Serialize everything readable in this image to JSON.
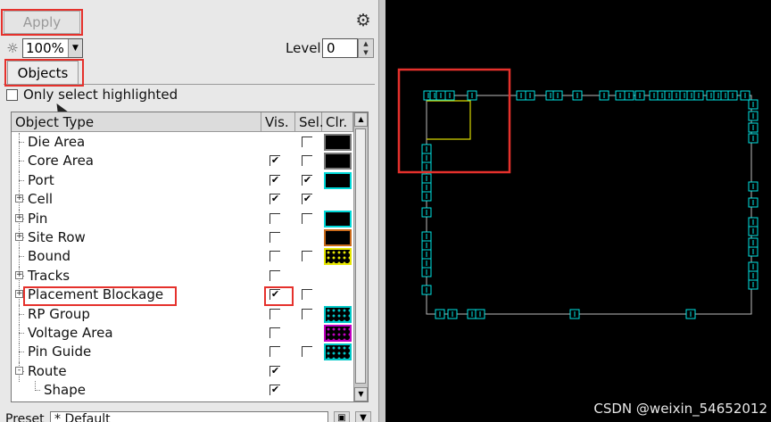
{
  "toolbar": {
    "apply_label": "Apply",
    "gear_icon": "gear-icon",
    "brightness_icon": "brightness-icon",
    "zoom_value": "100%",
    "level_label": "Level",
    "level_value": "0"
  },
  "tabs": [
    {
      "label": "Objects",
      "active": true
    }
  ],
  "only_select_highlighted": {
    "label": "Only select highlighted",
    "checked": false
  },
  "table": {
    "headers": {
      "type": "Object Type",
      "vis": "Vis.",
      "sel": "Sel.",
      "clr": "Clr."
    },
    "rows": [
      {
        "label": "Die Area",
        "expander": "",
        "vis": null,
        "sel": false,
        "swatch": {
          "color": "#000000",
          "border": "#7a7a7a",
          "pattern": "solid"
        }
      },
      {
        "label": "Core Area",
        "expander": "",
        "vis": true,
        "sel": false,
        "swatch": {
          "color": "#000000",
          "border": "#7a7a7a",
          "pattern": "solid"
        }
      },
      {
        "label": "Port",
        "expander": "",
        "vis": true,
        "sel": true,
        "swatch": {
          "color": "#000000",
          "border": "#00d8d8",
          "pattern": "solid"
        }
      },
      {
        "label": "Cell",
        "expander": "+",
        "vis": true,
        "sel": true,
        "swatch": null
      },
      {
        "label": "Pin",
        "expander": "+",
        "vis": false,
        "sel": false,
        "swatch": {
          "color": "#000000",
          "border": "#00d8d8",
          "pattern": "solid"
        }
      },
      {
        "label": "Site Row",
        "expander": "+",
        "vis": false,
        "sel": null,
        "swatch": {
          "color": "#000000",
          "border": "#c96a1a",
          "pattern": "solid"
        }
      },
      {
        "label": "Bound",
        "expander": "",
        "vis": false,
        "sel": false,
        "swatch": {
          "color": "#000000",
          "border": "#e6e600",
          "pattern": "dots",
          "dot": "#e6e600"
        }
      },
      {
        "label": "Tracks",
        "expander": "+",
        "vis": false,
        "sel": null,
        "swatch": null
      },
      {
        "label": "Placement Blockage",
        "expander": "+",
        "vis": true,
        "sel": false,
        "swatch": null
      },
      {
        "label": "RP Group",
        "expander": "",
        "vis": false,
        "sel": false,
        "swatch": {
          "color": "#000000",
          "border": "#00c8c8",
          "pattern": "dots",
          "dot": "#00c8c8"
        }
      },
      {
        "label": "Voltage Area",
        "expander": "",
        "vis": false,
        "sel": null,
        "swatch": {
          "color": "#000000",
          "border": "#c000c0",
          "pattern": "dots",
          "dot": "#c000c0"
        }
      },
      {
        "label": "Pin Guide",
        "expander": "",
        "vis": false,
        "sel": false,
        "swatch": {
          "color": "#000000",
          "border": "#00c8c8",
          "pattern": "dots",
          "dot": "#00c8c8"
        }
      },
      {
        "label": "Route",
        "expander": "-",
        "vis": true,
        "sel": null,
        "swatch": null
      },
      {
        "label": "Shape",
        "expander": "",
        "vis": true,
        "sel": null,
        "swatch": null,
        "child": true
      }
    ]
  },
  "preset": {
    "label": "Preset",
    "value": "* Default"
  },
  "watermark": "CSDN @weixin_54652012",
  "colors": {
    "pin": "#00e5e5",
    "die_outline": "#bcbcbc",
    "bound": "#d8d800",
    "highlight": "#e5312c"
  }
}
